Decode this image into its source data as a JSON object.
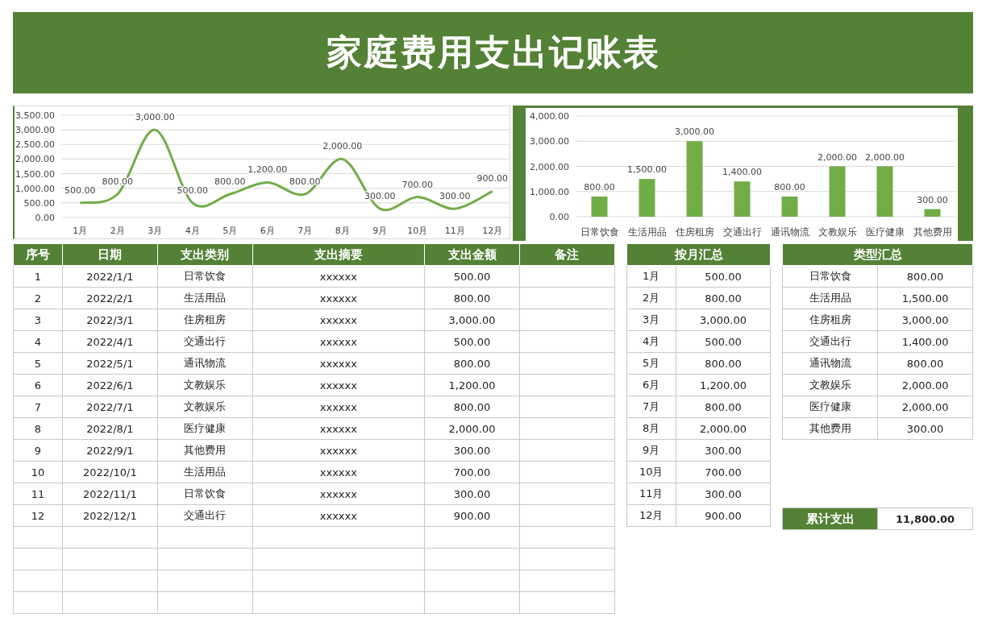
{
  "title": "家庭费用支出记账表",
  "line_chart": {
    "chart_data": {
      "type": "line",
      "categories": [
        "1月",
        "2月",
        "3月",
        "4月",
        "5月",
        "6月",
        "7月",
        "8月",
        "9月",
        "10月",
        "11月",
        "12月"
      ],
      "grid": true,
      "series": [
        {
          "color": "#70ad47",
          "values": [
            500,
            800,
            3000,
            500,
            800,
            1200,
            800,
            2000,
            300,
            700,
            300,
            900
          ]
        }
      ],
      "ylim": [
        0,
        3500
      ],
      "yticks": [
        {
          "value": 0,
          "label": "0.00"
        },
        {
          "value": 500,
          "label": "500.00"
        },
        {
          "value": 1000,
          "label": "1,000.00"
        },
        {
          "value": 1500,
          "label": "1,500.00"
        },
        {
          "value": 2000,
          "label": "2,000.00"
        },
        {
          "value": 2500,
          "label": "2,500.00"
        },
        {
          "value": 3000,
          "label": "3,000.00"
        },
        {
          "value": 3500,
          "label": "3,500.00"
        }
      ],
      "value_labels": [
        "500.00",
        "800.00",
        "3,000.00",
        "500.00",
        "800.00",
        "1,200.00",
        "800.00",
        "2,000.00",
        "300.00",
        "700.00",
        "300.00",
        "900.00"
      ]
    }
  },
  "bar_chart": {
    "chart_data": {
      "type": "bar",
      "categories": [
        "日常饮食",
        "生活用品",
        "住房租房",
        "交通出行",
        "通讯物流",
        "文教娱乐",
        "医疗健康",
        "其他费用"
      ],
      "grid": true,
      "series": [
        {
          "color": "#70ad47",
          "values": [
            800,
            1500,
            3000,
            1400,
            800,
            2000,
            2000,
            300
          ]
        }
      ],
      "ylim": [
        0,
        4000
      ],
      "yticks": [
        {
          "value": 0,
          "label": "0.00"
        },
        {
          "value": 1000,
          "label": "1,000.00"
        },
        {
          "value": 2000,
          "label": "2,000.00"
        },
        {
          "value": 3000,
          "label": "3,000.00"
        },
        {
          "value": 4000,
          "label": "4,000.00"
        }
      ],
      "value_labels": [
        "800.00",
        "1,500.00",
        "3,000.00",
        "1,400.00",
        "800.00",
        "2,000.00",
        "2,000.00",
        "300.00"
      ]
    }
  },
  "expense_table": {
    "columns": [
      "序号",
      "日期",
      "支出类别",
      "支出摘要",
      "支出金额",
      "备注"
    ],
    "rows": [
      {
        "no": "1",
        "date": "2022/1/1",
        "category": "日常饮食",
        "summary": "xxxxxx",
        "amount": "500.00"
      },
      {
        "no": "2",
        "date": "2022/2/1",
        "category": "生活用品",
        "summary": "xxxxxx",
        "amount": "800.00"
      },
      {
        "no": "3",
        "date": "2022/3/1",
        "category": "住房租房",
        "summary": "xxxxxx",
        "amount": "3,000.00"
      },
      {
        "no": "4",
        "date": "2022/4/1",
        "category": "交通出行",
        "summary": "xxxxxx",
        "amount": "500.00"
      },
      {
        "no": "5",
        "date": "2022/5/1",
        "category": "通讯物流",
        "summary": "xxxxxx",
        "amount": "800.00"
      },
      {
        "no": "6",
        "date": "2022/6/1",
        "category": "文教娱乐",
        "summary": "xxxxxx",
        "amount": "1,200.00"
      },
      {
        "no": "7",
        "date": "2022/7/1",
        "category": "文教娱乐",
        "summary": "xxxxxx",
        "amount": "800.00"
      },
      {
        "no": "8",
        "date": "2022/8/1",
        "category": "医疗健康",
        "summary": "xxxxxx",
        "amount": "2,000.00"
      },
      {
        "no": "9",
        "date": "2022/9/1",
        "category": "其他费用",
        "summary": "xxxxxx",
        "amount": "300.00"
      },
      {
        "no": "10",
        "date": "2022/10/1",
        "category": "生活用品",
        "summary": "xxxxxx",
        "amount": "700.00"
      },
      {
        "no": "11",
        "date": "2022/11/1",
        "category": "日常饮食",
        "summary": "xxxxxx",
        "amount": "300.00"
      },
      {
        "no": "12",
        "date": "2022/12/1",
        "category": "交通出行",
        "summary": "xxxxxx",
        "amount": "900.00"
      }
    ]
  },
  "monthly_summary": {
    "title": "按月汇总",
    "rows": [
      {
        "month": "1月",
        "amount": "500.00"
      },
      {
        "month": "2月",
        "amount": "800.00"
      },
      {
        "month": "3月",
        "amount": "3,000.00"
      },
      {
        "month": "4月",
        "amount": "500.00"
      },
      {
        "month": "5月",
        "amount": "800.00"
      },
      {
        "month": "6月",
        "amount": "1,200.00"
      },
      {
        "month": "7月",
        "amount": "800.00"
      },
      {
        "month": "8月",
        "amount": "2,000.00"
      },
      {
        "month": "9月",
        "amount": "300.00"
      },
      {
        "month": "10月",
        "amount": "700.00"
      },
      {
        "month": "11月",
        "amount": "300.00"
      },
      {
        "month": "12月",
        "amount": "900.00"
      }
    ]
  },
  "type_summary": {
    "title": "类型汇总",
    "rows": [
      {
        "category": "日常饮食",
        "amount": "800.00"
      },
      {
        "category": "生活用品",
        "amount": "1,500.00"
      },
      {
        "category": "住房租房",
        "amount": "3,000.00"
      },
      {
        "category": "交通出行",
        "amount": "1,400.00"
      },
      {
        "category": "通讯物流",
        "amount": "800.00"
      },
      {
        "category": "文教娱乐",
        "amount": "2,000.00"
      },
      {
        "category": "医疗健康",
        "amount": "2,000.00"
      },
      {
        "category": "其他费用",
        "amount": "300.00"
      }
    ]
  },
  "total": {
    "label": "累计支出",
    "value": "11,800.00"
  }
}
